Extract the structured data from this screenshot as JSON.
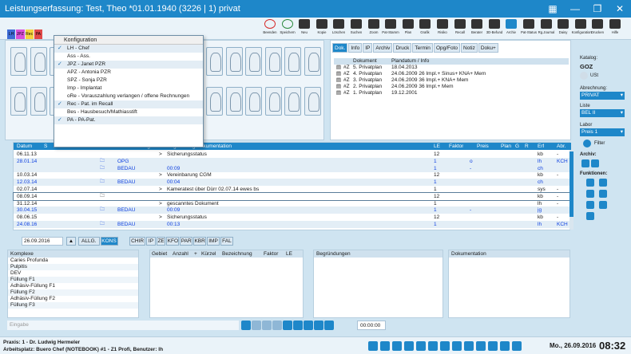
{
  "window": {
    "title": "Leistungserfassung: Test, Theo *01.01.1940 (3226 | 1) privat"
  },
  "toolbar": [
    {
      "label": "Beenden",
      "color": "#d62828"
    },
    {
      "label": "Speichern",
      "color": "#2b8a3e"
    },
    {
      "label": "Neu",
      "color": "#333333"
    },
    {
      "label": "Kopie",
      "color": "#333333"
    },
    {
      "label": "Löschen",
      "color": "#333333"
    },
    {
      "label": "Suchen",
      "color": "#333333"
    },
    {
      "label": "Zoom",
      "color": "#333333"
    },
    {
      "label": "Pat-Stamm",
      "color": "#333333"
    },
    {
      "label": "Plan",
      "color": "#333333"
    },
    {
      "label": "Grafik",
      "color": "#333333"
    },
    {
      "label": "Risiko",
      "color": "#333333"
    },
    {
      "label": "Recall",
      "color": "#333333"
    },
    {
      "label": "Berater",
      "color": "#333333"
    },
    {
      "label": "3D-Befund",
      "color": "#333333"
    },
    {
      "label": "Archiv",
      "color": "#1e87c9"
    },
    {
      "label": "Pat-Status",
      "color": "#333333"
    },
    {
      "label": "Rg.Journal",
      "color": "#333333"
    },
    {
      "label": "Daisy",
      "color": "#333333"
    },
    {
      "label": "Konfiguration",
      "color": "#333333"
    },
    {
      "label": "Drucken",
      "color": "#333333"
    },
    {
      "label": "Hilfe",
      "color": "#333333"
    }
  ],
  "flags": [
    {
      "label": "LH",
      "color": "#3d6bd6"
    },
    {
      "label": "JPZ",
      "color": "#d94fd9"
    },
    {
      "label": "Rec",
      "color": "#f5d33b"
    },
    {
      "label": "PA",
      "color": "#e04848"
    }
  ],
  "dropdown": {
    "header": "Konfiguration",
    "items": [
      {
        "label": "LH - Chef",
        "checked": true
      },
      {
        "label": "Ass - Ass.",
        "checked": false
      },
      {
        "label": "JPZ - Janet PZR",
        "checked": true
      },
      {
        "label": "APZ - Antonia PZR",
        "checked": false
      },
      {
        "label": "SPZ - Sonja PZR",
        "checked": false
      },
      {
        "label": "Imp - Implantat",
        "checked": false
      },
      {
        "label": "oRe - Vorauszahlung verlangen / offene Rechnungen",
        "checked": false
      },
      {
        "label": "Rec - Pat. im Recall",
        "checked": true
      },
      {
        "label": "Bes - Hausbesuch/Mathiasstift",
        "checked": false
      },
      {
        "label": "PA - PA-Pat.",
        "checked": true
      }
    ]
  },
  "doc": {
    "tabs": [
      "Dok.",
      "Info",
      "IP",
      "Archiv",
      "Druck",
      "Termin",
      "Opg/Foto",
      "Notiz",
      "Doku+"
    ],
    "active_tab": "Dok.",
    "headers": {
      "dokument": "Dokument",
      "plandatum": "Plandatum / Info"
    },
    "rows": [
      {
        "type": "#Z",
        "doc": "5. Privatplan",
        "info": "18.04.2013"
      },
      {
        "type": "#Z",
        "doc": "4. Privatplan",
        "info": "24.06.2009 26 Impl.+ Sinus+ KNA+ Mem"
      },
      {
        "type": "#Z",
        "doc": "3. Privatplan",
        "info": "24.06.2009 36 Impl.+ KNA+ Mem"
      },
      {
        "type": "#Z",
        "doc": "2. Privatplan",
        "info": "24.06.2009 36 Impl.+ Mem"
      },
      {
        "type": "#Z",
        "doc": "1. Privatplan",
        "info": "19.12.2001"
      }
    ]
  },
  "right": {
    "katalog_label": "Katalog:",
    "katalog_value": "GOZ",
    "ust_label": "USt",
    "abrechnung_label": "Abrechnung:",
    "abrechnung_value": "PRIVAT",
    "liste_label": "Liste",
    "liste_value": "BEL II",
    "labor_label": "Labor",
    "labor_value": "Preis 1",
    "filter_label": "Filter",
    "archiv_label": "Archiv:",
    "funktionen_label": "Funktionen:"
  },
  "grid": {
    "headers": [
      "Datum",
      "S",
      "Bezieh",
      "Anzahl",
      "+",
      "Nr.",
      "Lage",
      "T",
      "Begründung/Dokumentation",
      "LE",
      "Faktor",
      "Preis",
      "Plan",
      "G",
      "R",
      "Erf",
      "Abr."
    ],
    "rows": [
      {
        "datum": "06.11.13",
        "nr": "",
        "text": "Sicherungsstatus",
        "le": "12",
        "faktor": "",
        "erf": "kb",
        "abr": "-",
        "blue": false,
        "alt": false
      },
      {
        "datum": "28.01.14",
        "nr": "OPG",
        "text": "",
        "le": "1",
        "faktor": "o",
        "erf": "lh",
        "abr": "KCH",
        "blue": true,
        "alt": true
      },
      {
        "datum": "",
        "nr": "BEDAU",
        "text": "00:09",
        "le": "1",
        "faktor": "-",
        "erf": "ch",
        "abr": "",
        "blue": true,
        "alt": true
      },
      {
        "datum": "10.03.14",
        "nr": "",
        "text": "Vereinbarung CGM",
        "le": "12",
        "faktor": "",
        "erf": "kb",
        "abr": "-",
        "blue": false,
        "alt": false
      },
      {
        "datum": "12.03.14",
        "nr": "BEDAU",
        "text": "00:04",
        "le": "1",
        "faktor": "",
        "erf": "ch",
        "abr": "",
        "blue": true,
        "alt": true
      },
      {
        "datum": "02.07.14",
        "nr": "",
        "text": "Kameratest über Dürr 02.07.14 ewes bs",
        "le": "1",
        "faktor": "",
        "erf": "sys",
        "abr": "-",
        "blue": false,
        "alt": false
      },
      {
        "datum": "08.09.14",
        "nr": "",
        "text": "",
        "le": "12",
        "faktor": "",
        "erf": "kb",
        "abr": "-",
        "blue": false,
        "alt": false,
        "current": true
      },
      {
        "datum": "31.12.14",
        "nr": "",
        "text": "gescanntes Dokument",
        "le": "1",
        "faktor": "",
        "erf": "lh",
        "abr": "-",
        "blue": false,
        "alt": false
      },
      {
        "datum": "30.04.15",
        "nr": "BEDAU",
        "text": "00:09",
        "le": "1",
        "faktor": "-",
        "erf": "jg",
        "abr": "",
        "blue": true,
        "alt": true
      },
      {
        "datum": "08.06.15",
        "nr": "",
        "text": "Sicherungsstatus",
        "le": "12",
        "faktor": "",
        "erf": "kb",
        "abr": "-",
        "blue": false,
        "alt": false
      },
      {
        "datum": "24.08.16",
        "nr": "BEDAU",
        "text": "00:13",
        "le": "1",
        "faktor": "",
        "erf": "lh",
        "abr": "KCH",
        "blue": true,
        "alt": true
      }
    ]
  },
  "filter": {
    "date": "26.09.2016",
    "buttons": [
      "ALLG.",
      "KONS"
    ],
    "active": "KONS",
    "categories": [
      "CHIR",
      "IP",
      "ZE",
      "KFO",
      "PAR",
      "KBR",
      "IMP",
      "FAL"
    ]
  },
  "komplexe": {
    "header": "Komplexe",
    "items": [
      "Caries Profunda",
      "Pulpitis",
      "DEV",
      "Füllung F1",
      "Adhäsiv-Füllung F1",
      "Füllung F2",
      "Adhäsiv-Füllung F2",
      "Füllung F3"
    ]
  },
  "gebiet_headers": [
    "Gebiet",
    "Anzahl",
    "+",
    "Kürzel",
    "Bezeichnung",
    "Faktor",
    "LE"
  ],
  "begruendungen_header": "Begründungen",
  "dokumentation_header": "Dokumentation",
  "input_placeholder": "Eingabe",
  "time_value": "00:00:00",
  "status": {
    "line1": "Praxis:  1 - Dr. Ludwig Hermeler",
    "line2": "Arbeitsplatz: Buero Chef (NOTEBOOK) #1 - Z1 Profi, Benutzer: lh",
    "date": "Mo., 26.09.2016",
    "time": "08:32"
  }
}
